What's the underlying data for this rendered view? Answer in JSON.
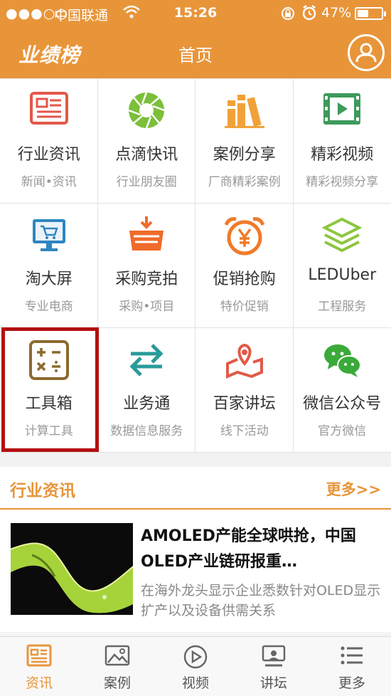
{
  "status_bar": {
    "signal": "●●●○○",
    "carrier": "中国联通",
    "time": "15:26",
    "battery_percent": "47%"
  },
  "header": {
    "logo": "业绩榜",
    "title": "首页"
  },
  "grid": [
    {
      "title": "行业资讯",
      "subtitle": "新闻•资讯",
      "icon": "newspaper-icon"
    },
    {
      "title": "点滴快讯",
      "subtitle": "行业朋友圈",
      "icon": "aperture-icon"
    },
    {
      "title": "案例分享",
      "subtitle": "厂商精彩案例",
      "icon": "books-icon"
    },
    {
      "title": "精彩视频",
      "subtitle": "精彩视频分享",
      "icon": "film-icon"
    },
    {
      "title": "淘大屏",
      "subtitle": "专业电商",
      "icon": "monitor-cart-icon"
    },
    {
      "title": "采购竞拍",
      "subtitle": "采购•项目",
      "icon": "basket-icon"
    },
    {
      "title": "促销抢购",
      "subtitle": "特价促销",
      "icon": "yen-alarm-icon"
    },
    {
      "title": "LEDUber",
      "subtitle": "工程服务",
      "icon": "layers-icon"
    },
    {
      "title": "工具箱",
      "subtitle": "计算工具",
      "icon": "calculator-icon"
    },
    {
      "title": "业务通",
      "subtitle": "数据信息服务",
      "icon": "exchange-arrows-icon"
    },
    {
      "title": "百家讲坛",
      "subtitle": "线下活动",
      "icon": "map-pin-icon"
    },
    {
      "title": "微信公众号",
      "subtitle": "官方微信",
      "icon": "wechat-icon"
    }
  ],
  "colors": {
    "brand": "#e8953a",
    "highlight_border": "#b30f0f"
  },
  "news_section": {
    "label": "行业资讯",
    "more": "更多>>",
    "items": [
      {
        "headline": "AMOLED产能全球哄抢，中国OLED产业链研报重…",
        "summary": "在海外龙头显示企业悉数针对OLED显示扩产以及设备供需关系"
      }
    ]
  },
  "tabbar": [
    {
      "label": "资讯",
      "icon": "news-icon",
      "active": true
    },
    {
      "label": "案例",
      "icon": "image-icon",
      "active": false
    },
    {
      "label": "视频",
      "icon": "play-icon",
      "active": false
    },
    {
      "label": "讲坛",
      "icon": "lecture-icon",
      "active": false
    },
    {
      "label": "更多",
      "icon": "list-icon",
      "active": false
    }
  ]
}
